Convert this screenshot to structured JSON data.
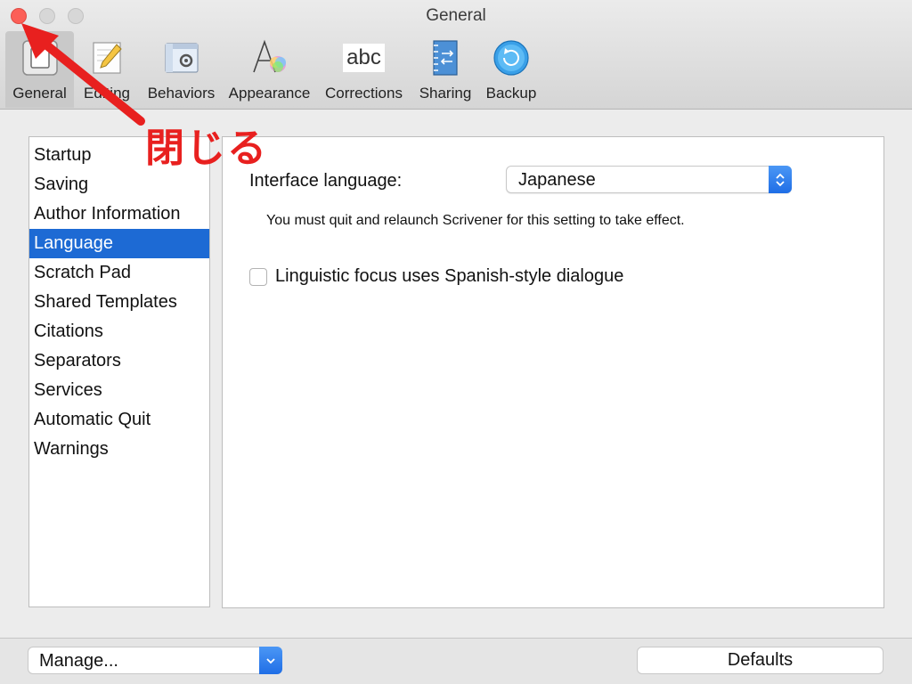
{
  "window": {
    "title": "General"
  },
  "toolbar": {
    "items": [
      {
        "label": "General",
        "icon": "general-icon",
        "active": true
      },
      {
        "label": "Editing",
        "icon": "editing-icon"
      },
      {
        "label": "Behaviors",
        "icon": "behaviors-icon"
      },
      {
        "label": "Appearance",
        "icon": "appearance-icon"
      },
      {
        "label": "Corrections",
        "icon": "corrections-icon",
        "icon_text": "abc"
      },
      {
        "label": "Sharing",
        "icon": "sharing-icon"
      },
      {
        "label": "Backup",
        "icon": "backup-icon"
      }
    ]
  },
  "sidebar": {
    "items": [
      {
        "label": "Startup"
      },
      {
        "label": "Saving"
      },
      {
        "label": "Author Information"
      },
      {
        "label": "Language",
        "selected": true
      },
      {
        "label": "Scratch Pad"
      },
      {
        "label": "Shared Templates"
      },
      {
        "label": "Citations"
      },
      {
        "label": "Separators"
      },
      {
        "label": "Services"
      },
      {
        "label": "Automatic Quit"
      },
      {
        "label": "Warnings"
      }
    ]
  },
  "panel": {
    "language_label": "Interface language:",
    "language_value": "Japanese",
    "hint": "You must quit and relaunch Scrivener for this setting to take effect.",
    "checkbox_label": "Linguistic focus uses Spanish-style dialogue",
    "checkbox_checked": false
  },
  "bottom": {
    "manage_label": "Manage...",
    "defaults_label": "Defaults"
  },
  "annotation": {
    "text": "閉じる",
    "color": "#e8201f"
  },
  "colors": {
    "selection": "#1d6ad4",
    "close_button": "#fc5f57",
    "accent_blue": "#1f6ee6"
  }
}
